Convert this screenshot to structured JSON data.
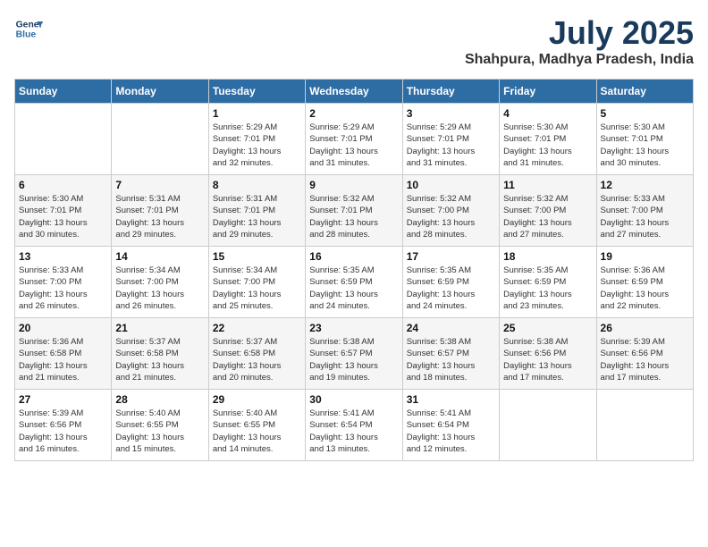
{
  "header": {
    "logo_line1": "General",
    "logo_line2": "Blue",
    "month": "July 2025",
    "location": "Shahpura, Madhya Pradesh, India"
  },
  "weekdays": [
    "Sunday",
    "Monday",
    "Tuesday",
    "Wednesday",
    "Thursday",
    "Friday",
    "Saturday"
  ],
  "weeks": [
    [
      {
        "day": "",
        "info": ""
      },
      {
        "day": "",
        "info": ""
      },
      {
        "day": "1",
        "info": "Sunrise: 5:29 AM\nSunset: 7:01 PM\nDaylight: 13 hours\nand 32 minutes."
      },
      {
        "day": "2",
        "info": "Sunrise: 5:29 AM\nSunset: 7:01 PM\nDaylight: 13 hours\nand 31 minutes."
      },
      {
        "day": "3",
        "info": "Sunrise: 5:29 AM\nSunset: 7:01 PM\nDaylight: 13 hours\nand 31 minutes."
      },
      {
        "day": "4",
        "info": "Sunrise: 5:30 AM\nSunset: 7:01 PM\nDaylight: 13 hours\nand 31 minutes."
      },
      {
        "day": "5",
        "info": "Sunrise: 5:30 AM\nSunset: 7:01 PM\nDaylight: 13 hours\nand 30 minutes."
      }
    ],
    [
      {
        "day": "6",
        "info": "Sunrise: 5:30 AM\nSunset: 7:01 PM\nDaylight: 13 hours\nand 30 minutes."
      },
      {
        "day": "7",
        "info": "Sunrise: 5:31 AM\nSunset: 7:01 PM\nDaylight: 13 hours\nand 29 minutes."
      },
      {
        "day": "8",
        "info": "Sunrise: 5:31 AM\nSunset: 7:01 PM\nDaylight: 13 hours\nand 29 minutes."
      },
      {
        "day": "9",
        "info": "Sunrise: 5:32 AM\nSunset: 7:01 PM\nDaylight: 13 hours\nand 28 minutes."
      },
      {
        "day": "10",
        "info": "Sunrise: 5:32 AM\nSunset: 7:00 PM\nDaylight: 13 hours\nand 28 minutes."
      },
      {
        "day": "11",
        "info": "Sunrise: 5:32 AM\nSunset: 7:00 PM\nDaylight: 13 hours\nand 27 minutes."
      },
      {
        "day": "12",
        "info": "Sunrise: 5:33 AM\nSunset: 7:00 PM\nDaylight: 13 hours\nand 27 minutes."
      }
    ],
    [
      {
        "day": "13",
        "info": "Sunrise: 5:33 AM\nSunset: 7:00 PM\nDaylight: 13 hours\nand 26 minutes."
      },
      {
        "day": "14",
        "info": "Sunrise: 5:34 AM\nSunset: 7:00 PM\nDaylight: 13 hours\nand 26 minutes."
      },
      {
        "day": "15",
        "info": "Sunrise: 5:34 AM\nSunset: 7:00 PM\nDaylight: 13 hours\nand 25 minutes."
      },
      {
        "day": "16",
        "info": "Sunrise: 5:35 AM\nSunset: 6:59 PM\nDaylight: 13 hours\nand 24 minutes."
      },
      {
        "day": "17",
        "info": "Sunrise: 5:35 AM\nSunset: 6:59 PM\nDaylight: 13 hours\nand 24 minutes."
      },
      {
        "day": "18",
        "info": "Sunrise: 5:35 AM\nSunset: 6:59 PM\nDaylight: 13 hours\nand 23 minutes."
      },
      {
        "day": "19",
        "info": "Sunrise: 5:36 AM\nSunset: 6:59 PM\nDaylight: 13 hours\nand 22 minutes."
      }
    ],
    [
      {
        "day": "20",
        "info": "Sunrise: 5:36 AM\nSunset: 6:58 PM\nDaylight: 13 hours\nand 21 minutes."
      },
      {
        "day": "21",
        "info": "Sunrise: 5:37 AM\nSunset: 6:58 PM\nDaylight: 13 hours\nand 21 minutes."
      },
      {
        "day": "22",
        "info": "Sunrise: 5:37 AM\nSunset: 6:58 PM\nDaylight: 13 hours\nand 20 minutes."
      },
      {
        "day": "23",
        "info": "Sunrise: 5:38 AM\nSunset: 6:57 PM\nDaylight: 13 hours\nand 19 minutes."
      },
      {
        "day": "24",
        "info": "Sunrise: 5:38 AM\nSunset: 6:57 PM\nDaylight: 13 hours\nand 18 minutes."
      },
      {
        "day": "25",
        "info": "Sunrise: 5:38 AM\nSunset: 6:56 PM\nDaylight: 13 hours\nand 17 minutes."
      },
      {
        "day": "26",
        "info": "Sunrise: 5:39 AM\nSunset: 6:56 PM\nDaylight: 13 hours\nand 17 minutes."
      }
    ],
    [
      {
        "day": "27",
        "info": "Sunrise: 5:39 AM\nSunset: 6:56 PM\nDaylight: 13 hours\nand 16 minutes."
      },
      {
        "day": "28",
        "info": "Sunrise: 5:40 AM\nSunset: 6:55 PM\nDaylight: 13 hours\nand 15 minutes."
      },
      {
        "day": "29",
        "info": "Sunrise: 5:40 AM\nSunset: 6:55 PM\nDaylight: 13 hours\nand 14 minutes."
      },
      {
        "day": "30",
        "info": "Sunrise: 5:41 AM\nSunset: 6:54 PM\nDaylight: 13 hours\nand 13 minutes."
      },
      {
        "day": "31",
        "info": "Sunrise: 5:41 AM\nSunset: 6:54 PM\nDaylight: 13 hours\nand 12 minutes."
      },
      {
        "day": "",
        "info": ""
      },
      {
        "day": "",
        "info": ""
      }
    ]
  ]
}
